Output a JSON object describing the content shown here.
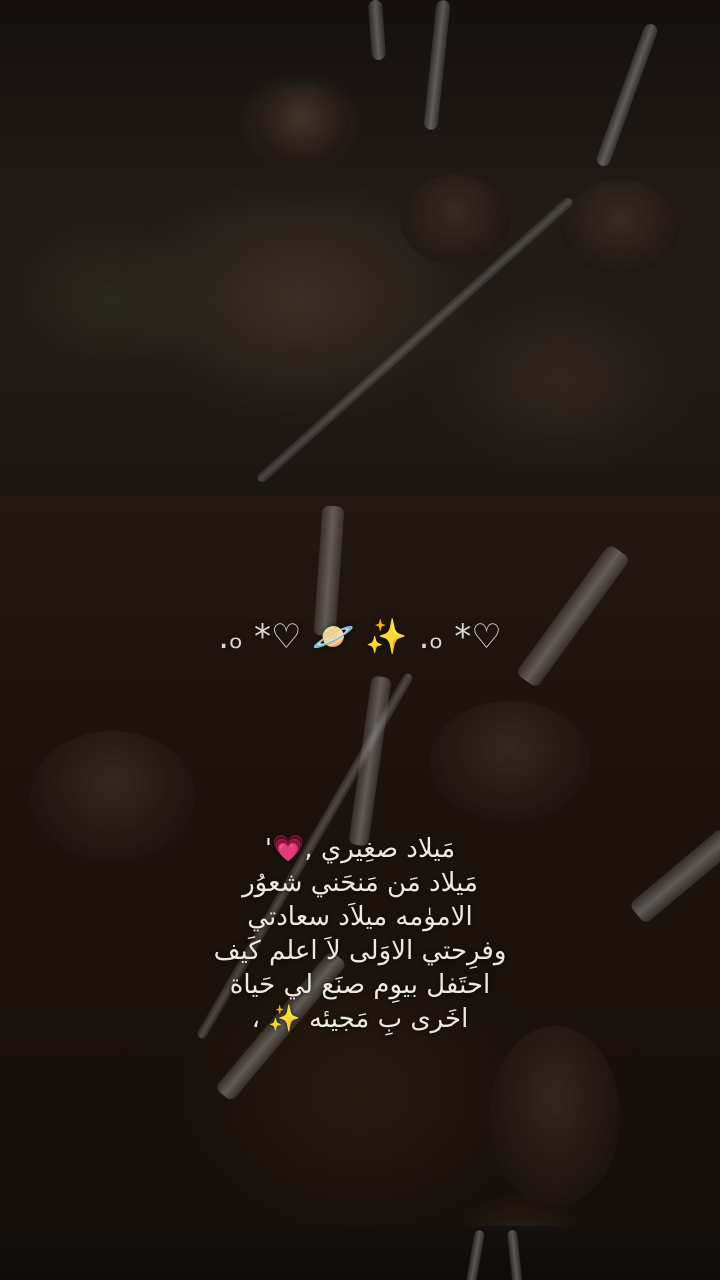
{
  "decoration": {
    "left_glyphs": ".ₒ *♡",
    "planet": "🪐",
    "sparkle": "✨",
    "right_glyphs": ".ₒ *♡"
  },
  "caption": {
    "lines": [
      "مَيلاد صغِيري ,💗'",
      "مَيلاد مَن مَنحَني شعوُر",
      "الاموٰمه ميلاَد سعادتي",
      "وفرِحتي الاوَلى لاَ اعلم كَيف",
      "احتَفل بيوِم صنَع لي حَياة",
      "اخَرى بِ مَجيئه ✨ ،"
    ]
  },
  "colors": {
    "caption_text": "#ece8e2",
    "heart": "#e0479e",
    "sparkle": "#f0d080",
    "background": "#0d0908"
  }
}
